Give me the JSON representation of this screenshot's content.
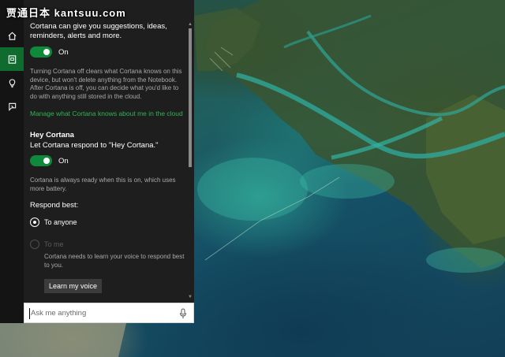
{
  "overlay": {
    "title": "贾通日本 kantsuu.com"
  },
  "rail": {
    "items": [
      {
        "icon": "home-icon",
        "active": false
      },
      {
        "icon": "notebook-icon",
        "active": true
      },
      {
        "icon": "lightbulb-icon",
        "active": false
      },
      {
        "icon": "feedback-icon",
        "active": false
      }
    ]
  },
  "settings": {
    "intro": "Cortana can give you suggestions, ideas, reminders, alerts and more.",
    "cortana_toggle": {
      "state": "On"
    },
    "off_desc": "Turning Cortana off clears what Cortana knows on this device, but won't delete anything from the Notebook. After Cortana is off, you can decide what you'd like to do with anything still stored in the cloud.",
    "manage_link": "Manage what Cortana knows about me in the cloud",
    "hey_title": "Hey Cortana",
    "hey_sub": "Let Cortana respond to \"Hey Cortana.\"",
    "hey_toggle": {
      "state": "On"
    },
    "hey_desc": "Cortana is always ready when this is on, which uses more battery.",
    "respond_label": "Respond best:",
    "options": [
      {
        "label": "To anyone",
        "checked": true,
        "disabled": false
      },
      {
        "label": "To me",
        "checked": false,
        "disabled": true
      }
    ],
    "to_me_note": "Cortana needs to learn your voice to respond best to you.",
    "learn_button": "Learn my voice"
  },
  "search": {
    "placeholder": "Ask me anything",
    "mic_icon": "microphone-icon"
  },
  "colors": {
    "accent": "#0e8a3a",
    "link": "#2eb553",
    "panel_bg": "#1e1e1e",
    "rail_bg": "#141414"
  }
}
